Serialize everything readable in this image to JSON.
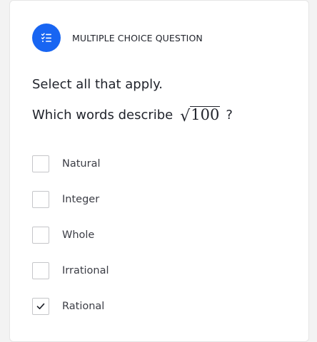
{
  "header": {
    "icon": "checklist-icon",
    "question_type": "MULTIPLE CHOICE QUESTION",
    "accent_color": "#1865f2"
  },
  "prompt": {
    "instruction": "Select all that apply.",
    "question_text": "Which words describe",
    "expression_radicand": "100",
    "question_mark": "?"
  },
  "options": [
    {
      "label": "Natural",
      "checked": false
    },
    {
      "label": "Integer",
      "checked": false
    },
    {
      "label": "Whole",
      "checked": false
    },
    {
      "label": "Irrational",
      "checked": false
    },
    {
      "label": "Rational",
      "checked": true
    }
  ]
}
